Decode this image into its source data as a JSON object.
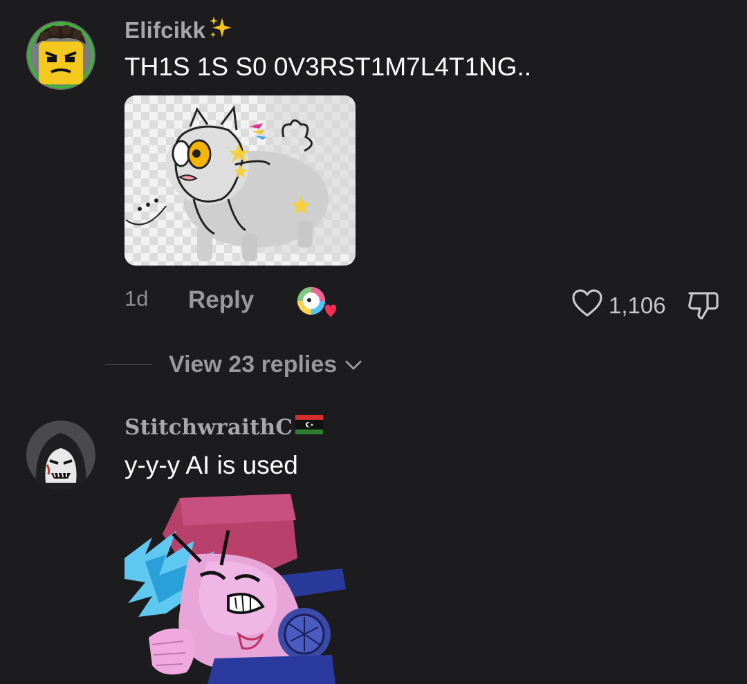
{
  "comments": [
    {
      "username": "Elifcikk",
      "username_badge": "sparkles-emoji",
      "text": "TH1S 1S S0 0V3RST1M7L4T1NG..",
      "sticker": "grey-cat-sticker",
      "time": "1d",
      "reply_label": "Reply",
      "creator_liked": true,
      "likes": "1,106",
      "view_replies_label": "View 23 replies"
    },
    {
      "username": "StitchwraithC",
      "username_badge": "libya-flag-emoji",
      "text": "y-y-y AI is used",
      "sticker": "boyfriend-fnf-sticker"
    }
  ],
  "colors": {
    "background": "#1c1c1e",
    "username": "#a8a8ab",
    "secondary_text": "#8e8e93",
    "comment_text": "#ffffff"
  }
}
